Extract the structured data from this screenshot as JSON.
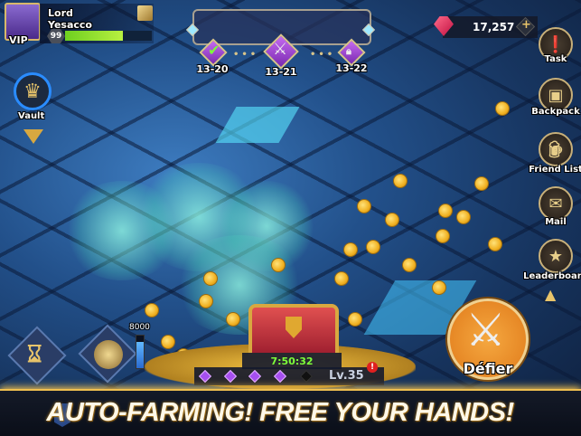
{
  "player": {
    "name": "Lord Yesacco",
    "vip_label": "VIP",
    "level": "99",
    "xp_fraction": 0.67
  },
  "stages": {
    "completed": "13-20",
    "current": "13-21",
    "locked": "13-22"
  },
  "currency": {
    "gems": "17,257",
    "add_label": "+"
  },
  "right_menu": [
    {
      "label": "Task",
      "icon": "task-icon"
    },
    {
      "label": "Backpack",
      "icon": "backpack-icon"
    },
    {
      "label": "Friend List",
      "icon": "friend-list-icon"
    },
    {
      "label": "Mail",
      "icon": "mail-icon"
    },
    {
      "label": "Leaderboard",
      "icon": "leaderboard-icon"
    }
  ],
  "vault": {
    "label": "Vault"
  },
  "energy": {
    "max_label": "8000",
    "fill_fraction": 0.8
  },
  "chest": {
    "timer": "7:50:32",
    "level": "Lv.35",
    "alert": "!",
    "filled_slots": 4,
    "total_slots": 5
  },
  "challenge": {
    "label": "Défier"
  },
  "banner": {
    "text": "AUTO-FARMING! FREE YOUR HANDS!"
  },
  "colors": {
    "xp_bar": "#8ee02a",
    "timer": "#7dff3a",
    "accent_gold": "#e8c46a",
    "challenge_orange": "#f0962a"
  }
}
